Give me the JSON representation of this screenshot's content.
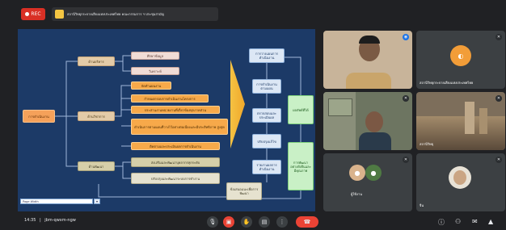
{
  "topbar": {
    "rec_label": "REC",
    "meeting_title": "สถานีวิทยุกระจายเสียงแห่งประเทศไทย คณะกรรมการ ฯ ประชุมสามัญ"
  },
  "slide": {
    "root": "การดำเนินงาน",
    "categories": [
      "ด้านบริหาร",
      "ด้านวิชาการ",
      "ด้านพัฒนา"
    ],
    "top_items": [
      "ศึกษาข้อมูล",
      "วิเคราะห์"
    ],
    "middle_items": [
      "จัดทำแผนงาน",
      "กำหนดกรอบการดำเนินงานโครงการ",
      "ประสานงานหน่วยงานที่เกี่ยวข้องทุกภาคส่วน",
      "ดำเนินการตามแผนที่วางไว้อย่างต่อเนื่องและมีประสิทธิภาพ สูงสุด",
      "ติดตามและประเมินผลการดำเนินงาน"
    ],
    "bottom_items": [
      "ส่งเสริมและพัฒนาบุคลากรทุกระดับ",
      "ปรับปรุงและพัฒนาระบบการทำงาน"
    ],
    "flow_steps": [
      "การวางแผนการดำเนินงาน",
      "การดำเนินงานตามแผน",
      "ตรวจสอบและประเมินผล",
      "ปรับปรุงแก้ไข",
      "รายงานผลการดำเนินงาน"
    ],
    "bottom_box": "ข้อเสนอแนะเพื่อการพัฒนา",
    "result_a": "ผลลัพธ์ที่ได้",
    "result_b": "การพัฒนาอย่างยั่งยืนและมีคุณภาพ",
    "zoom_value": "Page Width",
    "zoom_button": "▾"
  },
  "participants": [
    {
      "name": "",
      "mic": "mic-active"
    },
    {
      "name": "สถานีวิทยุกระจายเสียงแห่งประเทศไทย",
      "mic": "mic-off"
    },
    {
      "name": "",
      "mic": "mic-off"
    },
    {
      "name": "สถานีวิทยุ",
      "mic": "mic-off"
    },
    {
      "name": "ผู้ใช้งาน",
      "mic": "mic-off"
    },
    {
      "name": "จีน",
      "mic": "mic-off"
    }
  ],
  "bottombar": {
    "time": "14:35",
    "meeting_code": "jbm-qwxm-ngw",
    "controls": [
      "mic-icon",
      "camera-icon",
      "captions-icon",
      "raise-hand-icon",
      "present-icon",
      "more-icon",
      "leave-icon"
    ],
    "right_icons": [
      "info-icon",
      "people-icon",
      "chat-icon",
      "activities-icon"
    ]
  },
  "colors": {
    "accent_red": "#ea4335",
    "slide_bg": "#1c3a67",
    "root_orange": "#f5a15a",
    "green_result": "#c9f0c6"
  }
}
